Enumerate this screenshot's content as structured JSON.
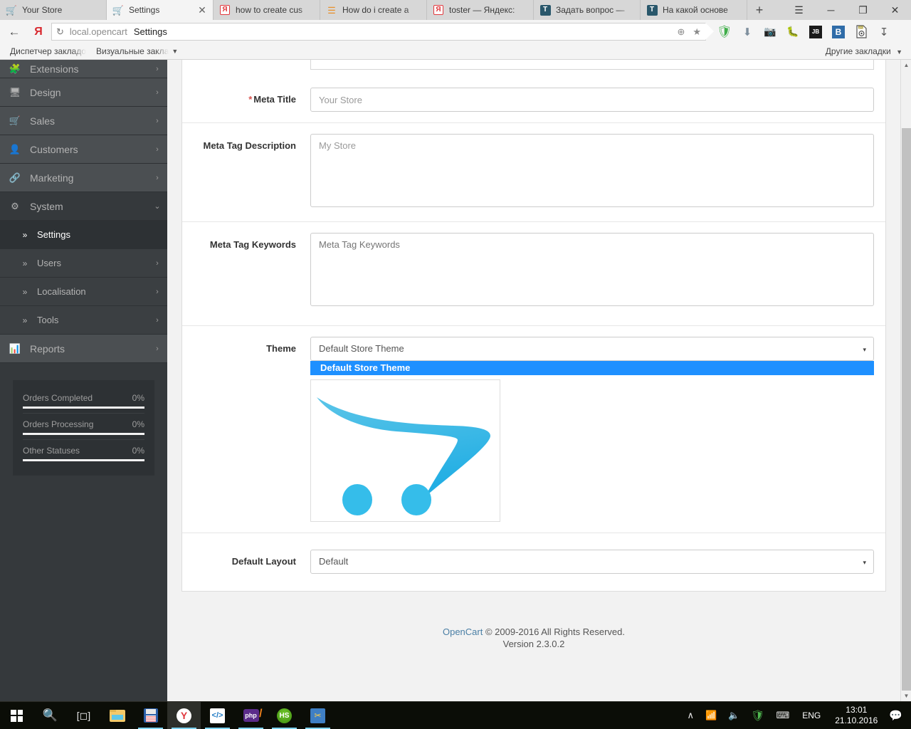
{
  "browser": {
    "tabs": [
      {
        "title": "Your Store",
        "favicon": "cart-icon",
        "active": false,
        "closable": false
      },
      {
        "title": "Settings",
        "favicon": "cart-icon",
        "active": true,
        "closable": true
      },
      {
        "title": "how to create cus",
        "favicon": "yandex-icon",
        "active": false,
        "closable": false
      },
      {
        "title": "How do i create a",
        "favicon": "stackoverflow-icon",
        "active": false,
        "closable": false
      },
      {
        "title": "toster — Яндекс:",
        "favicon": "yandex-icon",
        "active": false,
        "closable": false
      },
      {
        "title": "Задать вопрос —",
        "favicon": "toster-icon",
        "active": false,
        "closable": false
      },
      {
        "title": "На какой основе",
        "favicon": "toster-icon",
        "active": false,
        "closable": false
      }
    ],
    "new_tab_label": "+",
    "window_controls": {
      "menu": "☰",
      "minimize": "─",
      "maximize": "❐",
      "close": "✕"
    },
    "address": {
      "back_icon": "back-arrow-icon",
      "brand_icon": "Я",
      "reload_icon": "↻",
      "host": "local.opencart",
      "page_title": "Settings",
      "globe_icon": "⊕",
      "star_icon": "★"
    },
    "extension_icons": [
      "shield-icon",
      "download-arrow-icon",
      "camera-icon",
      "bug-icon",
      "jetbrains-icon",
      "vk-icon",
      "jpg-image-icon",
      "save-arrow-icon"
    ],
    "bookmarks": {
      "items": [
        "Диспетчер закладо",
        "Визуальные закла"
      ],
      "caret": "▼",
      "other": "Другие закладки",
      "other_caret": "▼"
    }
  },
  "sidebar": {
    "items": [
      {
        "label": "Extensions",
        "icon": "puzzle-icon",
        "caret": "›",
        "level": 1,
        "state": ""
      },
      {
        "label": "Design",
        "icon": "monitor-icon",
        "caret": "›",
        "level": 1,
        "state": ""
      },
      {
        "label": "Sales",
        "icon": "cart-icon",
        "caret": "›",
        "level": 1,
        "state": ""
      },
      {
        "label": "Customers",
        "icon": "user-icon",
        "caret": "›",
        "level": 1,
        "state": ""
      },
      {
        "label": "Marketing",
        "icon": "share-icon",
        "caret": "›",
        "level": 1,
        "state": ""
      },
      {
        "label": "System",
        "icon": "gear-icon",
        "caret": "⌄",
        "level": 1,
        "state": "open"
      },
      {
        "label": "Settings",
        "icon": "»",
        "caret": "",
        "level": 2,
        "state": "active"
      },
      {
        "label": "Users",
        "icon": "»",
        "caret": "›",
        "level": 2,
        "state": ""
      },
      {
        "label": "Localisation",
        "icon": "»",
        "caret": "›",
        "level": 2,
        "state": ""
      },
      {
        "label": "Tools",
        "icon": "»",
        "caret": "›",
        "level": 2,
        "state": ""
      },
      {
        "label": "Reports",
        "icon": "chart-icon",
        "caret": "›",
        "level": 1,
        "state": ""
      }
    ],
    "stats": [
      {
        "label": "Orders Completed",
        "value": "0%"
      },
      {
        "label": "Orders Processing",
        "value": "0%"
      },
      {
        "label": "Other Statuses",
        "value": "0%"
      }
    ]
  },
  "form": {
    "meta_title": {
      "label": "Meta Title",
      "required_marker": "*",
      "value": "Your Store"
    },
    "meta_description": {
      "label": "Meta Tag Description",
      "value": "My Store"
    },
    "meta_keywords": {
      "label": "Meta Tag Keywords",
      "value": "",
      "placeholder": "Meta Tag Keywords"
    },
    "theme": {
      "label": "Theme",
      "selected": "Default Store Theme",
      "caret": "▾",
      "open": true,
      "options": [
        "Default Store Theme"
      ],
      "preview_alt": "opencart-cart-logo"
    },
    "layout": {
      "label": "Default Layout",
      "selected": "Default",
      "caret": "▾"
    }
  },
  "footer": {
    "brand": "OpenCart",
    "copyright": "© 2009-2016 All Rights Reserved.",
    "version": "Version 2.3.0.2"
  },
  "scrollbar": {
    "up_arrow": "▲",
    "down_arrow": "▼"
  },
  "taskbar": {
    "buttons": [
      {
        "name": "start-button",
        "icon": "windows-logo-icon",
        "running": false,
        "active": false
      },
      {
        "name": "search-button",
        "icon": "search-icon",
        "running": false,
        "active": false
      },
      {
        "name": "task-view-button",
        "icon": "task-view-icon",
        "running": false,
        "active": false
      },
      {
        "name": "file-explorer",
        "icon": "folder-icon",
        "running": false,
        "active": false
      },
      {
        "name": "notepadpp",
        "icon": "floppy-save-icon",
        "running": true,
        "active": false
      },
      {
        "name": "yandex-browser",
        "icon": "yandex-icon",
        "running": true,
        "active": true
      },
      {
        "name": "code-editor",
        "icon": "code-brackets-icon",
        "running": true,
        "active": false
      },
      {
        "name": "phpstorm",
        "icon": "php-icon",
        "running": true,
        "active": false
      },
      {
        "name": "hs-app",
        "icon": "hs-icon",
        "running": true,
        "active": false
      },
      {
        "name": "snipping-tool",
        "icon": "scissors-icon",
        "running": true,
        "active": false
      }
    ],
    "tray": {
      "chevron": "∧",
      "wifi_icon": "wifi-icon",
      "volume_icon": "volume-icon",
      "antivirus_icon": "antivirus-shield-icon",
      "keyboard_icon": "keyboard-icon",
      "language": "ENG",
      "time": "13:01",
      "date": "21.10.2016",
      "notification_icon": "notification-icon"
    }
  }
}
